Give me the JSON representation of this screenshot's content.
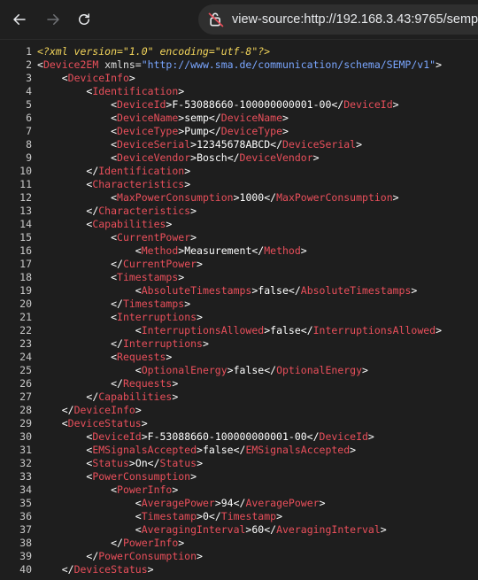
{
  "browser": {
    "url": "view-source:http://192.168.3.43:9765/semp"
  },
  "lines": [
    {
      "n": "1",
      "indent": 0,
      "kind": "pi",
      "text": "<?xml version=\"1.0\" encoding=\"utf-8\"?>"
    },
    {
      "n": "2",
      "indent": 0,
      "kind": "open_attr",
      "tag": "Device2EM",
      "attr": "xmlns",
      "value": "http://www.sma.de/communication/schema/SEMP/v1"
    },
    {
      "n": "3",
      "indent": 1,
      "kind": "open",
      "tag": "DeviceInfo"
    },
    {
      "n": "4",
      "indent": 2,
      "kind": "open",
      "tag": "Identification"
    },
    {
      "n": "5",
      "indent": 3,
      "kind": "elem",
      "tag": "DeviceId",
      "text": "F-53088660-100000000001-00"
    },
    {
      "n": "6",
      "indent": 3,
      "kind": "elem",
      "tag": "DeviceName",
      "text": "semp"
    },
    {
      "n": "7",
      "indent": 3,
      "kind": "elem",
      "tag": "DeviceType",
      "text": "Pump"
    },
    {
      "n": "8",
      "indent": 3,
      "kind": "elem",
      "tag": "DeviceSerial",
      "text": "12345678ABCD"
    },
    {
      "n": "9",
      "indent": 3,
      "kind": "elem",
      "tag": "DeviceVendor",
      "text": "Bosch"
    },
    {
      "n": "10",
      "indent": 2,
      "kind": "close",
      "tag": "Identification"
    },
    {
      "n": "11",
      "indent": 2,
      "kind": "open",
      "tag": "Characteristics"
    },
    {
      "n": "12",
      "indent": 3,
      "kind": "elem",
      "tag": "MaxPowerConsumption",
      "text": "1000"
    },
    {
      "n": "13",
      "indent": 2,
      "kind": "close",
      "tag": "Characteristics"
    },
    {
      "n": "14",
      "indent": 2,
      "kind": "open",
      "tag": "Capabilities"
    },
    {
      "n": "15",
      "indent": 3,
      "kind": "open",
      "tag": "CurrentPower"
    },
    {
      "n": "16",
      "indent": 4,
      "kind": "elem",
      "tag": "Method",
      "text": "Measurement"
    },
    {
      "n": "17",
      "indent": 3,
      "kind": "close",
      "tag": "CurrentPower"
    },
    {
      "n": "18",
      "indent": 3,
      "kind": "open",
      "tag": "Timestamps"
    },
    {
      "n": "19",
      "indent": 4,
      "kind": "elem",
      "tag": "AbsoluteTimestamps",
      "text": "false"
    },
    {
      "n": "20",
      "indent": 3,
      "kind": "close",
      "tag": "Timestamps"
    },
    {
      "n": "21",
      "indent": 3,
      "kind": "open",
      "tag": "Interruptions"
    },
    {
      "n": "22",
      "indent": 4,
      "kind": "elem",
      "tag": "InterruptionsAllowed",
      "text": "false"
    },
    {
      "n": "23",
      "indent": 3,
      "kind": "close",
      "tag": "Interruptions"
    },
    {
      "n": "24",
      "indent": 3,
      "kind": "open",
      "tag": "Requests"
    },
    {
      "n": "25",
      "indent": 4,
      "kind": "elem",
      "tag": "OptionalEnergy",
      "text": "false"
    },
    {
      "n": "26",
      "indent": 3,
      "kind": "close",
      "tag": "Requests"
    },
    {
      "n": "27",
      "indent": 2,
      "kind": "close",
      "tag": "Capabilities"
    },
    {
      "n": "28",
      "indent": 1,
      "kind": "close",
      "tag": "DeviceInfo"
    },
    {
      "n": "29",
      "indent": 1,
      "kind": "open",
      "tag": "DeviceStatus"
    },
    {
      "n": "30",
      "indent": 2,
      "kind": "elem",
      "tag": "DeviceId",
      "text": "F-53088660-100000000001-00"
    },
    {
      "n": "31",
      "indent": 2,
      "kind": "elem",
      "tag": "EMSignalsAccepted",
      "text": "false"
    },
    {
      "n": "32",
      "indent": 2,
      "kind": "elem",
      "tag": "Status",
      "text": "On"
    },
    {
      "n": "33",
      "indent": 2,
      "kind": "open",
      "tag": "PowerConsumption"
    },
    {
      "n": "34",
      "indent": 3,
      "kind": "open",
      "tag": "PowerInfo"
    },
    {
      "n": "35",
      "indent": 4,
      "kind": "elem",
      "tag": "AveragePower",
      "text": "94"
    },
    {
      "n": "36",
      "indent": 4,
      "kind": "elem",
      "tag": "Timestamp",
      "text": "0"
    },
    {
      "n": "37",
      "indent": 4,
      "kind": "elem",
      "tag": "AveragingInterval",
      "text": "60"
    },
    {
      "n": "38",
      "indent": 3,
      "kind": "close",
      "tag": "PowerInfo"
    },
    {
      "n": "39",
      "indent": 2,
      "kind": "close",
      "tag": "PowerConsumption"
    },
    {
      "n": "40",
      "indent": 1,
      "kind": "close",
      "tag": "DeviceStatus"
    }
  ]
}
